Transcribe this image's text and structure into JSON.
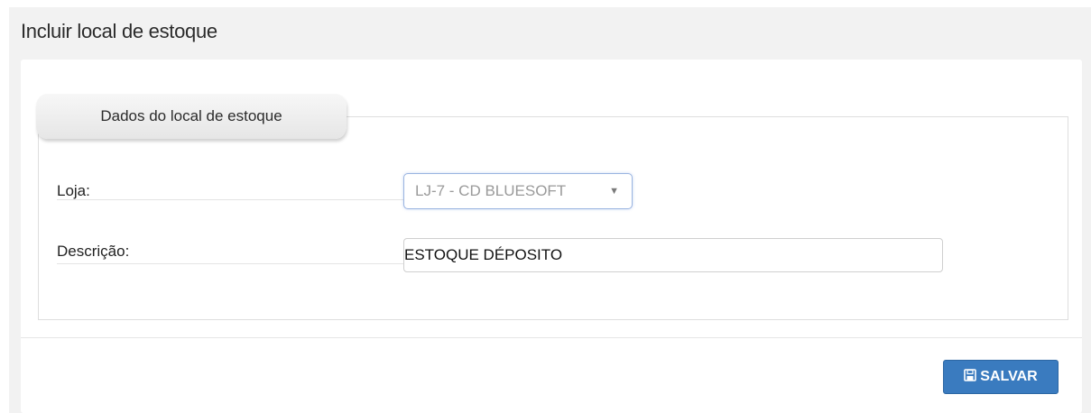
{
  "page": {
    "title": "Incluir local de estoque"
  },
  "form": {
    "section_title": "Dados do local de estoque",
    "loja_label": "Loja:",
    "loja_value": "LJ-7 - CD BLUESOFT",
    "descricao_label": "Descrição:",
    "descricao_value": "ESTOQUE DÉPOSITO"
  },
  "actions": {
    "save_label": "SALVAR",
    "save_icon": "floppy-disk-icon"
  },
  "colors": {
    "primary_button": "#3a7bbf",
    "page_background": "#f2f2f2"
  }
}
